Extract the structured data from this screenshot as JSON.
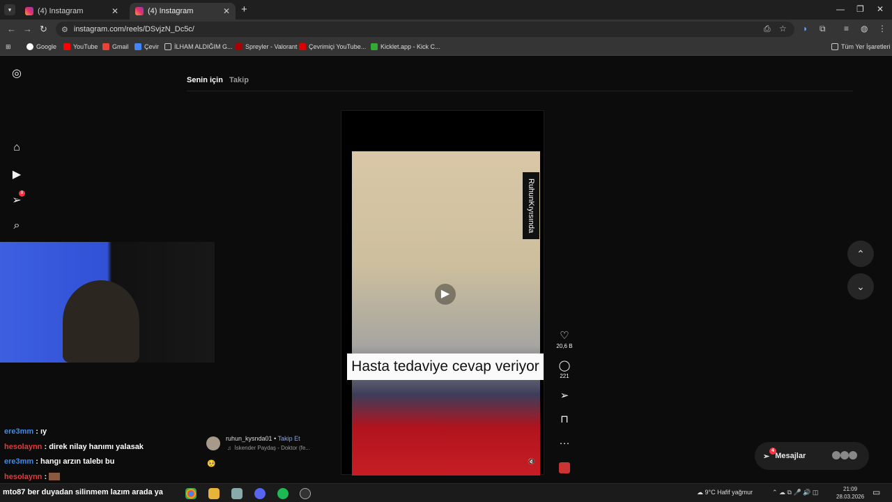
{
  "browser": {
    "tabs": [
      {
        "title": "(4) Instagram"
      },
      {
        "title": "(4) Instagram"
      }
    ],
    "url": "instagram.com/reels/DSvjzN_Dc5c/",
    "bookmarks": [
      "Google",
      "YouTube",
      "Gmail",
      "Çevir",
      "İLHAM ALDIĞIM G...",
      "Spreyler - Valorant",
      "Çevrimiçi YouTube...",
      "Kicklet.app - Kick C..."
    ],
    "all_bookmarks": "Tüm Yer İşaretleri"
  },
  "instagram": {
    "feed_tabs": [
      "Senin için",
      "Takip"
    ],
    "reel": {
      "caption": "Hasta tedaviye cevap veriyor",
      "watermark": "RuhunKıyısında",
      "likes": "20,6 B",
      "comments": "221",
      "author": "ruhun_kysnda01",
      "follow": "Takip Et",
      "audio": "İskender Paydaş - Doktor (fe..."
    },
    "messages": {
      "label": "Mesajlar",
      "badge": "4"
    },
    "notif_badge": "8"
  },
  "chat": [
    {
      "user": "ere3mm",
      "text": "ıy",
      "color": "blue"
    },
    {
      "user": "hesolaynn",
      "text": "direk nilay hanımı yalasak",
      "color": "red"
    },
    {
      "user": "ere3mm",
      "text": "hangı arzın talebı bu",
      "color": "blue"
    },
    {
      "user": "hesolaynn",
      "text": "",
      "color": "red"
    }
  ],
  "overlay_text": "mto87  ber duyadan silinmem lazım arada ya",
  "taskbar": {
    "weather": "9°C  Hafif yağmur",
    "time": "21:09",
    "date": "28.03.2026"
  }
}
